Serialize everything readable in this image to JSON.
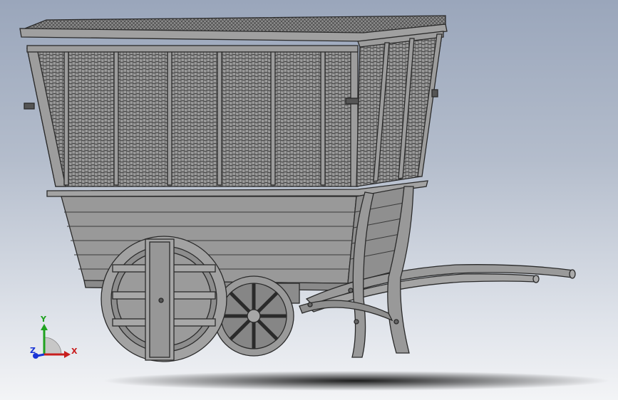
{
  "viewport": {
    "background_top": "#9aa6bb",
    "background_bottom": "#f3f4f6",
    "model_color": "#8c8c8c",
    "edge_color": "#2a2a2a"
  },
  "model": {
    "name": "",
    "parts": [
      "wicker-basket",
      "lid-grille",
      "plank-body",
      "spoked-wheels",
      "handles",
      "legs"
    ]
  },
  "triad": {
    "x_label": "X",
    "y_label": "Y",
    "z_label": "Z",
    "x_color": "#c81e1e",
    "y_color": "#1fa21f",
    "z_color": "#1a35d6"
  }
}
